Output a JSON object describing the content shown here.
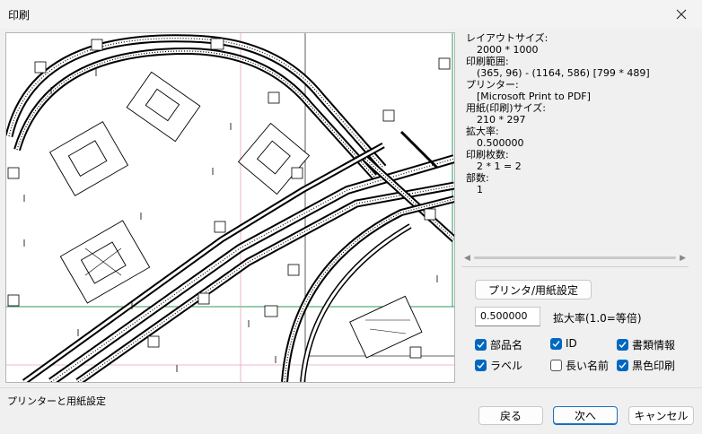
{
  "window": {
    "title": "印刷"
  },
  "info": {
    "layout_size_label": "レイアウトサイズ:",
    "layout_size_value": "2000 * 1000",
    "print_range_label": "印刷範囲:",
    "print_range_value": "(365, 96) - (1164, 586) [799 * 489]",
    "printer_label": "プリンター:",
    "printer_value": "[Microsoft Print to PDF]",
    "paper_label": "用紙(印刷)サイズ:",
    "paper_value": "210 * 297",
    "scale_label": "拡大率:",
    "scale_value": "0.500000",
    "sheets_label": "印刷枚数:",
    "sheets_value": "2 * 1 = 2",
    "copies_label": "部数:",
    "copies_value": "1"
  },
  "controls": {
    "printer_setup_button": "プリンタ/用紙設定",
    "zoom_value": "0.500000",
    "zoom_label": "拡大率(1.0=等倍)"
  },
  "checkboxes": [
    {
      "label": "部品名",
      "checked": true
    },
    {
      "label": "ID",
      "checked": true
    },
    {
      "label": "書類情報",
      "checked": true
    },
    {
      "label": "ラベル",
      "checked": true
    },
    {
      "label": "長い名前",
      "checked": false
    },
    {
      "label": "黒色印刷",
      "checked": true
    }
  ],
  "status_text": "プリンターと用紙設定",
  "buttons": {
    "back": "戻る",
    "next": "次へ",
    "cancel": "キャンセル"
  },
  "colors": {
    "accent": "#0067c0",
    "page_border": "#2e9a5e",
    "fold_line": "#e8a0c8"
  }
}
